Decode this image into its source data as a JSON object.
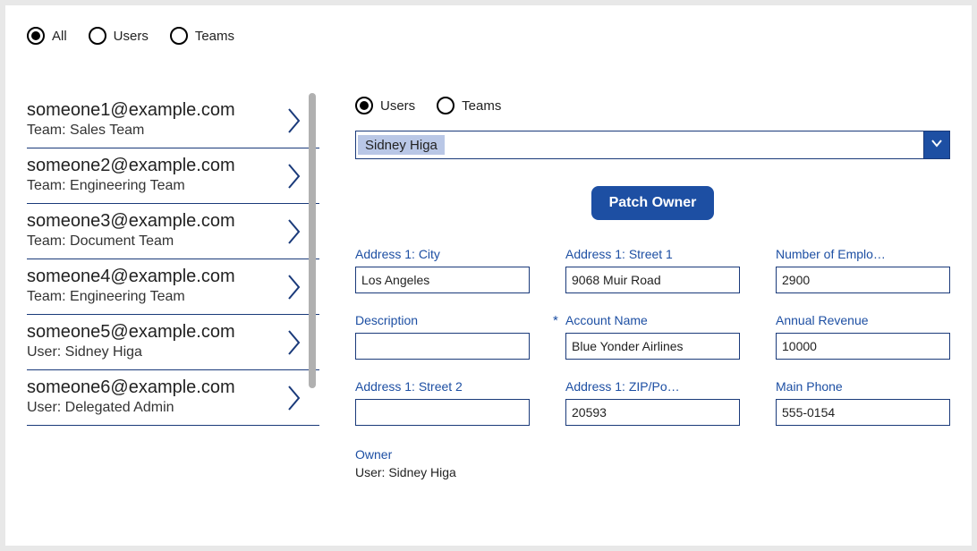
{
  "topRadios": {
    "all": "All",
    "users": "Users",
    "teams": "Teams",
    "selected": "all"
  },
  "detailRadios": {
    "users": "Users",
    "teams": "Teams",
    "selected": "users"
  },
  "selectValue": "Sidney Higa",
  "patchButton": "Patch Owner",
  "list": [
    {
      "title": "someone1@example.com",
      "sub": "Team: Sales Team"
    },
    {
      "title": "someone2@example.com",
      "sub": "Team: Engineering Team"
    },
    {
      "title": "someone3@example.com",
      "sub": "Team: Document Team"
    },
    {
      "title": "someone4@example.com",
      "sub": "Team: Engineering Team"
    },
    {
      "title": "someone5@example.com",
      "sub": "User: Sidney Higa"
    },
    {
      "title": "someone6@example.com",
      "sub": "User: Delegated Admin"
    }
  ],
  "fields": {
    "city": {
      "label": "Address 1: City",
      "value": "Los Angeles"
    },
    "street1": {
      "label": "Address 1: Street 1",
      "value": "9068 Muir Road"
    },
    "employees": {
      "label": "Number of Emplo…",
      "value": "2900"
    },
    "description": {
      "label": "Description",
      "value": ""
    },
    "account": {
      "label": "Account Name",
      "value": "Blue Yonder Airlines",
      "required": true
    },
    "revenue": {
      "label": "Annual Revenue",
      "value": "10000"
    },
    "street2": {
      "label": "Address 1: Street 2",
      "value": ""
    },
    "zip": {
      "label": "Address 1: ZIP/Po…",
      "value": "20593"
    },
    "phone": {
      "label": "Main Phone",
      "value": "555-0154"
    }
  },
  "owner": {
    "label": "Owner",
    "value": "User: Sidney Higa"
  }
}
